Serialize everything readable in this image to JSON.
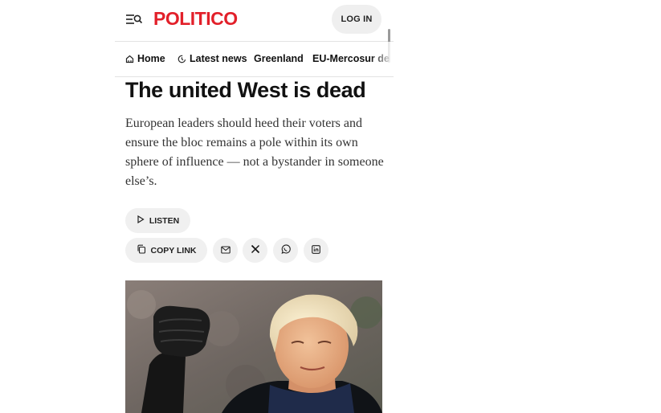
{
  "header": {
    "logo": "POLITICO",
    "login_label": "LOG IN",
    "colors": {
      "brand": "#e2202a"
    }
  },
  "nav": {
    "items": [
      {
        "label": "Home",
        "icon": "home-icon"
      },
      {
        "label": "Latest news",
        "icon": "clock-icon"
      },
      {
        "label": "Greenland"
      },
      {
        "label": "EU-Mercosur de"
      }
    ]
  },
  "article": {
    "headline": "The united West is dead",
    "dek": "European leaders should heed their voters and ensure the bloc remains a pole within its own sphere of influence — not a bystander in someone else’s.",
    "listen_label": "LISTEN",
    "copy_link_label": "COPY LINK",
    "share_icons": [
      "mail-icon",
      "x-icon",
      "whatsapp-icon",
      "linkedin-icon"
    ]
  }
}
